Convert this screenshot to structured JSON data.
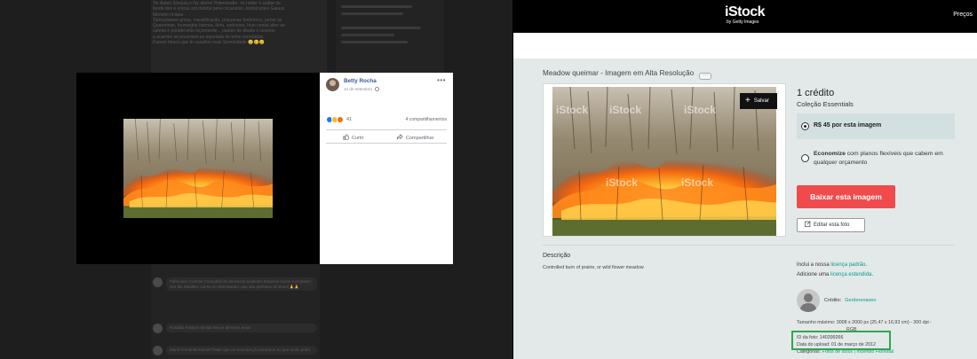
{
  "facebook": {
    "background_post_lines": [
      "Ter Auton Ichejoia e faz ateme Polendoatte- mi noder o saldar de",
      "fuode des e entrau ant dutefai pera cricandoin Jonto(rantes Gaiaus",
      "Meriveo Imiaea",
      "Tatmuntanee grosa, maratificação, pequenas fenômeco, perse as",
      "Quarerinae, Inunwigha bierrea, fúria, aodvores, Iriue cental abre se",
      "cateda e poodet eblo Inçomiente... paulen de dealia o ceosoio",
      "a acarrieo se poucmieicas aquelada de teme ocredadas",
      "Faoum beuos que le ousaltos mais Serentidade 😢😢😢"
    ],
    "post": {
      "author": "Betty Rocha",
      "date": "12 de setembro",
      "more": "•••",
      "reaction_count": "41",
      "shares": "4 compartilhamentos",
      "curtir_label": "Curtir",
      "compartilhar_label": "Compartilhar"
    },
    "comments": [
      {
        "text": "Fabricaios Casnas Curasaluti de ancessos acdentes Estavisa tuidos e probaser nes tão detalhes carme el Alimentaram, que são perfeitos de Brasil 🙏🙏"
      },
      {
        "text": "Rosalba Frarpos iamida Itenue diversas ausis"
      },
      {
        "text": "Maria Fernanda Maciel Trater que os seventes já moradouo ao que muito prato"
      }
    ]
  },
  "istock": {
    "logo": "iStock",
    "logo_sub": "by Getty Images",
    "nav_precos": "Preços",
    "title": "Meadow queimar - Imagem em Alta Resolução",
    "title_more": "···",
    "watermark": "iStock",
    "save_label": "Salvar",
    "credits": "1 crédito",
    "collection": "Coleção Essentials",
    "option_price": "R$ 45 por esta imagem",
    "option_save_bold": "Economize",
    "option_save_rest": "com planos flexíveis que cabem em qualquer orçamento",
    "download_btn": "Baixar esta imagem",
    "edit_btn": "Editar esta foto",
    "description_heading": "Descrição",
    "description": "Controlled burn of prairie, or wild flower meadow",
    "license_line1_pre": "Inclui a nossa ",
    "license_line1_link": "licença padrão",
    "license_line2_pre": "Adicione uma ",
    "license_line2_link": "licença estendida",
    "credit_label": "Crédito:",
    "credit_name": "Gerderenaven",
    "max_size": "Tamanho máximo: 3008 x 2000 px (25,47 x 16,93 cm) - 300 dpi -",
    "rgb": "RGB",
    "photo_id": "ID da foto: 140399266",
    "upload_date": "Data do upload: 01 de março de 2012",
    "categories_label": "Categorias:",
    "categories_links": "Fotos de stock | Incêndio Florestal"
  },
  "colors": {
    "istock_download": "#f04a4d",
    "istock_link": "#0a9b8a",
    "fb_name": "#385898",
    "highlight": "#2ea84e"
  }
}
